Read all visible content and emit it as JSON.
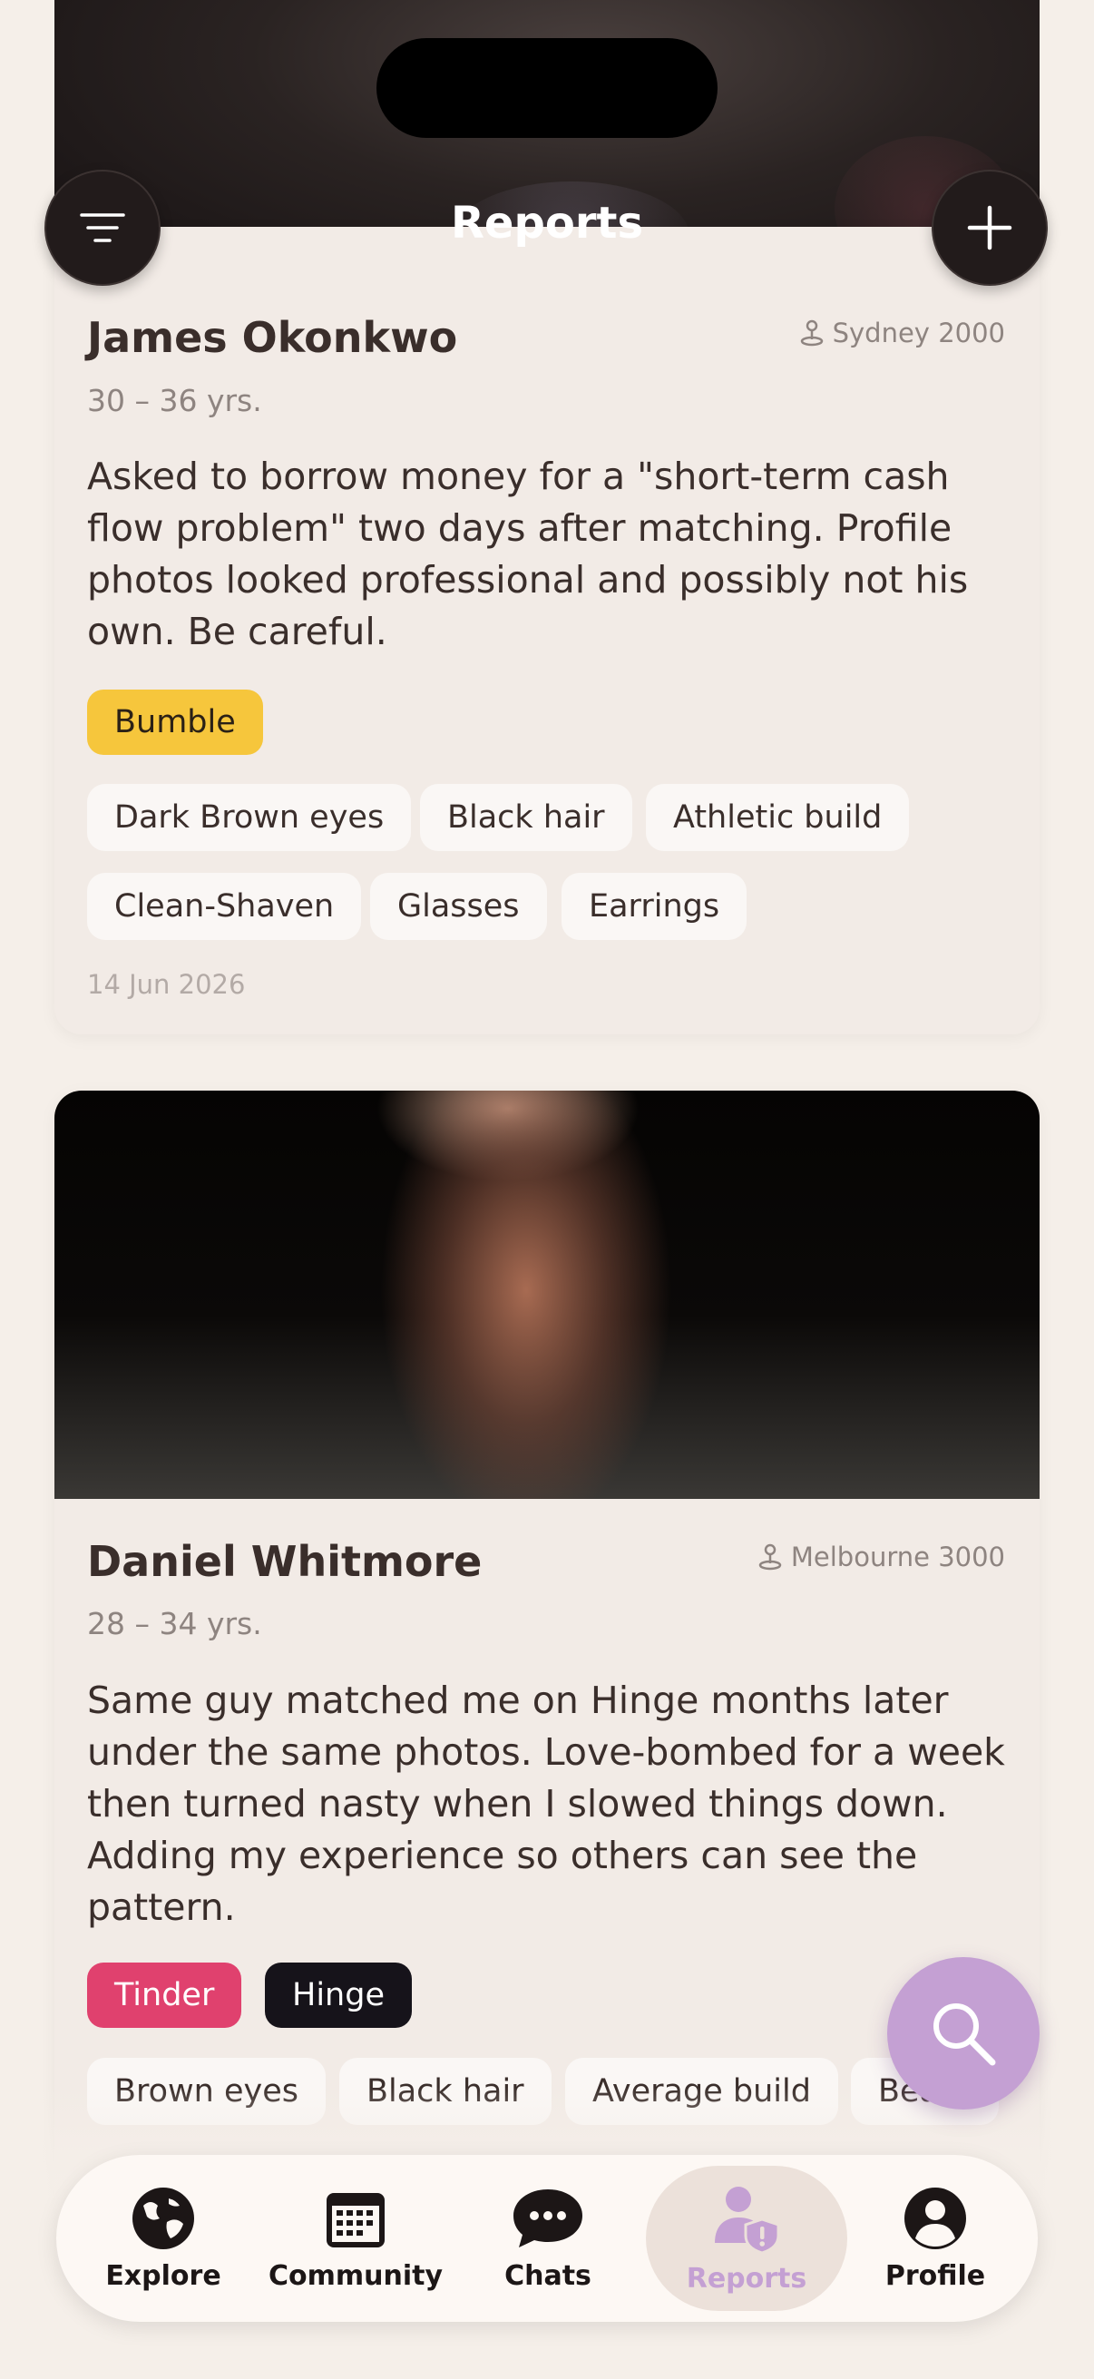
{
  "header": {
    "title": "Reports"
  },
  "reports": [
    {
      "name": "James Okonkwo",
      "location": "Sydney 2000",
      "age_range": "30 – 36 yrs.",
      "description": "Asked to borrow money for a \"short-term cash flow problem\" two days after matching. Profile photos looked professional and possibly not his own. Be careful.",
      "apps": [
        "Bumble"
      ],
      "traits": [
        "Dark Brown eyes",
        "Black hair",
        "Athletic build",
        "Clean-Shaven",
        "Glasses",
        "Earrings"
      ],
      "date": "14 Jun 2026"
    },
    {
      "name": "Daniel Whitmore",
      "location": "Melbourne 3000",
      "age_range": "28 – 34 yrs.",
      "description": "Same guy matched me on Hinge months later under the same photos. Love-bombed for a week then turned nasty when I slowed things down. Adding my experience so others can see the pattern.",
      "apps": [
        "Tinder",
        "Hinge"
      ],
      "traits": [
        "Brown eyes",
        "Black hair",
        "Average build",
        "Beard"
      ]
    }
  ],
  "colors": {
    "bumble": "#f6c63c",
    "tinder": "#e0416e",
    "hinge": "#16131a",
    "accent": "#c4a0d3"
  },
  "nav": {
    "items": [
      {
        "label": "Explore",
        "icon": "globe-icon"
      },
      {
        "label": "Community",
        "icon": "calendar-icon"
      },
      {
        "label": "Chats",
        "icon": "chat-bubble-icon"
      },
      {
        "label": "Reports",
        "icon": "person-shield-icon"
      },
      {
        "label": "Profile",
        "icon": "profile-icon"
      }
    ],
    "active": "Reports"
  }
}
